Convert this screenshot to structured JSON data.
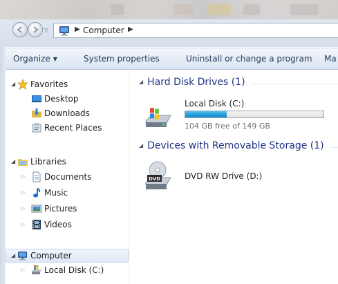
{
  "window": {
    "breadcrumb": "Computer",
    "location_icon": "computer-icon"
  },
  "toolbar": {
    "organize": "Organize",
    "system_properties": "System properties",
    "uninstall": "Uninstall or change a program",
    "more": "Ma"
  },
  "nav": {
    "favorites": {
      "label": "Favorites",
      "icon": "star-icon",
      "items": [
        {
          "label": "Desktop",
          "icon": "desktop-icon"
        },
        {
          "label": "Downloads",
          "icon": "downloads-icon"
        },
        {
          "label": "Recent Places",
          "icon": "recent-places-icon"
        }
      ]
    },
    "libraries": {
      "label": "Libraries",
      "icon": "libraries-icon",
      "items": [
        {
          "label": "Documents",
          "icon": "documents-icon"
        },
        {
          "label": "Music",
          "icon": "music-icon"
        },
        {
          "label": "Pictures",
          "icon": "pictures-icon"
        },
        {
          "label": "Videos",
          "icon": "videos-icon"
        }
      ]
    },
    "computer": {
      "label": "Computer",
      "icon": "computer-icon",
      "items": [
        {
          "label": "Local Disk (C:)",
          "icon": "local-disk-icon"
        }
      ]
    }
  },
  "content": {
    "groups": [
      {
        "title": "Hard Disk Drives (1)",
        "drives": [
          {
            "name": "Local Disk (C:)",
            "free_text": "104 GB free of 149 GB",
            "used_fraction": 0.3,
            "icon": "windows-drive-icon"
          }
        ]
      },
      {
        "title": "Devices with Removable Storage (1)",
        "drives": [
          {
            "name": "DVD RW Drive (D:)",
            "icon": "dvd-drive-icon",
            "badge": "DVD"
          }
        ]
      }
    ]
  },
  "colors": {
    "group_header": "#1e3287",
    "toolbar_text": "#1e395b",
    "usage_bar": "#26a0da",
    "selection": "#dde8f6"
  }
}
